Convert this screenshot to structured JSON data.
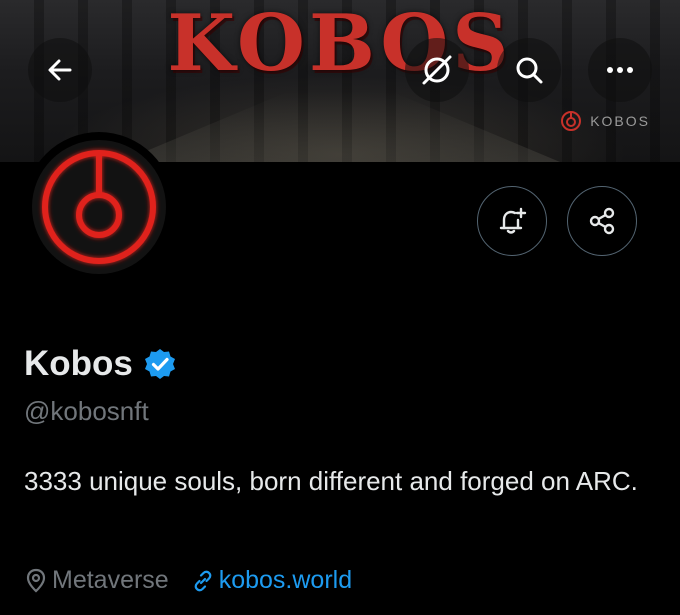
{
  "banner": {
    "title": "KOBOS",
    "tag_label": "KOBOS"
  },
  "toolbar": {
    "back_icon": "arrow-left-icon",
    "translate_icon": "no-translate-icon",
    "search_icon": "search-icon",
    "more_icon": "more-dots-icon"
  },
  "profile": {
    "name": "Kobos",
    "verified": true,
    "handle": "@kobosnft",
    "bio": "3333 unique souls, born different and forged on ARC.",
    "location": "Metaverse",
    "website": "kobos.world",
    "avatar_icon": "red-power-ring-logo"
  },
  "actions": {
    "notify_icon": "bell-plus-icon",
    "share_icon": "share-icon"
  },
  "colors": {
    "background": "#000000",
    "accent": "#1d9bf0",
    "brand_red": "#e0201c",
    "muted": "#71767b"
  }
}
